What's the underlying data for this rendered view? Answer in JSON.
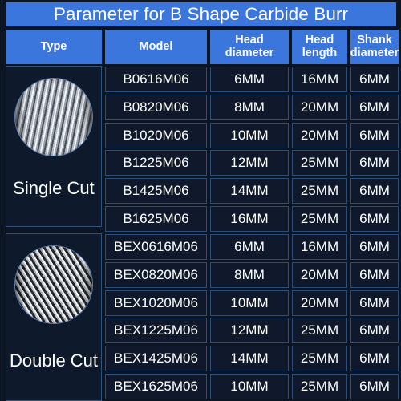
{
  "title": "Parameter for B Shape Carbide Burr",
  "colors": {
    "accent_blue": "#3b76dd",
    "cell_background": "#10192b",
    "cell_border": "#2d4d79",
    "page_background": "#0b1524",
    "text": "#ffffff"
  },
  "table": {
    "headers": {
      "type": "Type",
      "model": "Model",
      "head_diameter": "Head\ndiameter",
      "head_length": "Head\nlength",
      "shank_diameter": "Shank\ndiameter"
    },
    "sections": [
      {
        "type_label": "Single Cut",
        "photo_icon": "single-cut-burr-photo",
        "rows": [
          {
            "model": "B0616M06",
            "head_diameter": "6MM",
            "head_length": "16MM",
            "shank_diameter": "6MM"
          },
          {
            "model": "B0820M06",
            "head_diameter": "8MM",
            "head_length": "20MM",
            "shank_diameter": "6MM"
          },
          {
            "model": "B1020M06",
            "head_diameter": "10MM",
            "head_length": "20MM",
            "shank_diameter": "6MM"
          },
          {
            "model": "B1225M06",
            "head_diameter": "12MM",
            "head_length": "25MM",
            "shank_diameter": "6MM"
          },
          {
            "model": "B1425M06",
            "head_diameter": "14MM",
            "head_length": "25MM",
            "shank_diameter": "6MM"
          },
          {
            "model": "B1625M06",
            "head_diameter": "16MM",
            "head_length": "25MM",
            "shank_diameter": "6MM"
          }
        ]
      },
      {
        "type_label": "Double Cut",
        "photo_icon": "double-cut-burr-photo",
        "rows": [
          {
            "model": "BEX0616M06",
            "head_diameter": "6MM",
            "head_length": "16MM",
            "shank_diameter": "6MM"
          },
          {
            "model": "BEX0820M06",
            "head_diameter": "8MM",
            "head_length": "20MM",
            "shank_diameter": "6MM"
          },
          {
            "model": "BEX1020M06",
            "head_diameter": "10MM",
            "head_length": "20MM",
            "shank_diameter": "6MM"
          },
          {
            "model": "BEX1225M06",
            "head_diameter": "12MM",
            "head_length": "25MM",
            "shank_diameter": "6MM"
          },
          {
            "model": "BEX1425M06",
            "head_diameter": "14MM",
            "head_length": "25MM",
            "shank_diameter": "6MM"
          },
          {
            "model": "BEX1625M06",
            "head_diameter": "10MM",
            "head_length": "25MM",
            "shank_diameter": "6MM"
          }
        ]
      }
    ]
  }
}
